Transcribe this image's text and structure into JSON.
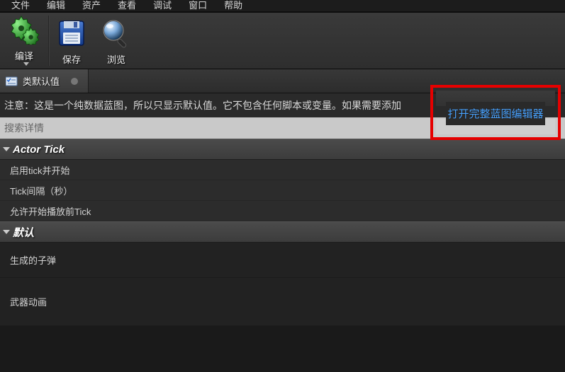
{
  "menu": {
    "file": "文件",
    "edit": "编辑",
    "asset": "资产",
    "view": "查看",
    "debug": "调试",
    "window": "窗口",
    "help": "帮助"
  },
  "toolbar": {
    "compile": "编译",
    "save": "保存",
    "preview": "浏览"
  },
  "tab": {
    "title": "类默认值"
  },
  "info": {
    "note": "注意：这是一个纯数据蓝图，所以只显示默认值。它不包含任何脚本或变量。如果需要添加",
    "open_full": "打开完整蓝图编辑器"
  },
  "search": {
    "placeholder": "搜索详情"
  },
  "categories": {
    "actor_tick": {
      "title": "Actor Tick",
      "rows": {
        "start_with_tick": "启用tick并开始",
        "tick_interval": "Tick间隔（秒）",
        "allow_tick_before_begin": "允许开始播放前Tick"
      }
    },
    "defaults": {
      "title": "默认",
      "rows": {
        "spawned_bullet": "生成的子弹",
        "weapon_anim": "武器动画"
      }
    }
  }
}
